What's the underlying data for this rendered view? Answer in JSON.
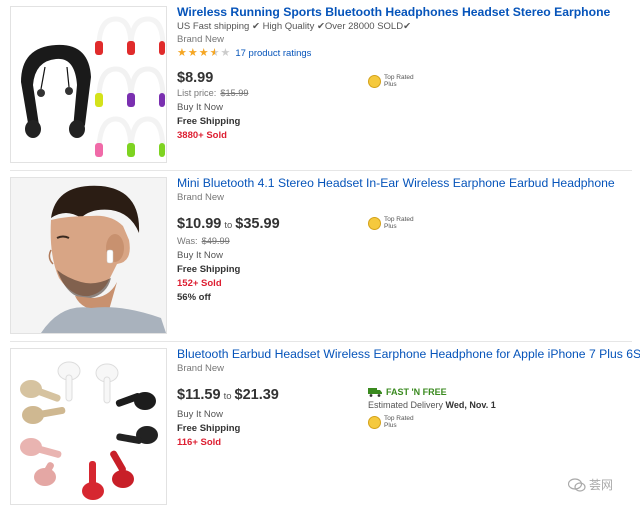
{
  "listings": [
    {
      "title": "Wireless Running Sports Bluetooth Headphones Headset Stereo Earphone",
      "subtitle": "US Fast shipping ✔ High Quality ✔Over 28000 SOLD✔",
      "condition": "Brand New",
      "rating": 3.5,
      "ratings_count": "17 product ratings",
      "price": "$8.99",
      "list_price_label": "List price:",
      "list_price": "$15.99",
      "buy_format": "Buy It Now",
      "shipping": "Free Shipping",
      "sold": "3880+ Sold",
      "badge": [
        "Top Rated",
        "Plus"
      ]
    },
    {
      "title": "Mini Bluetooth 4.1 Stereo Headset In-Ear Wireless Earphone Earbud Headphone",
      "condition": "Brand New",
      "price_low": "$10.99",
      "price_to": "to",
      "price_high": "$35.99",
      "was_label": "Was:",
      "was_price": "$49.99",
      "buy_format": "Buy It Now",
      "shipping": "Free Shipping",
      "sold": "152+ Sold",
      "discount": "56% off",
      "badge": [
        "Top Rated",
        "Plus"
      ]
    },
    {
      "title": "Bluetooth Earbud Headset Wireless Earphone Headphone for Apple iPhone 7 Plus 6S",
      "condition": "Brand New",
      "price_low": "$11.59",
      "price_to": "to",
      "price_high": "$21.39",
      "buy_format": "Buy It Now",
      "shipping": "Free Shipping",
      "sold": "116+ Sold",
      "fast_label": "FAST 'N FREE",
      "delivery_label": "Estimated Delivery",
      "delivery_date": "Wed, Nov. 1",
      "badge": [
        "Top Rated",
        "Plus"
      ]
    }
  ],
  "watermark": "荟网",
  "colors": {
    "link": "#0654ba",
    "sold": "#dd1e31",
    "star": "#f5a623",
    "fast": "#3a8a1f"
  }
}
